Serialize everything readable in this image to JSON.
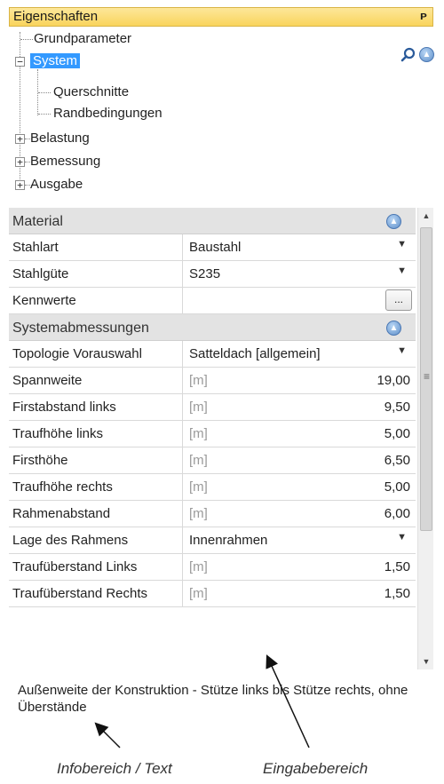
{
  "panel": {
    "title": "Eigenschaften",
    "pin_glyph": "ᴩ"
  },
  "tree": {
    "items": [
      {
        "label": "Grundparameter"
      },
      {
        "label": "System"
      },
      {
        "label": "Querschnitte"
      },
      {
        "label": "Randbedingungen"
      },
      {
        "label": "Belastung"
      },
      {
        "label": "Bemessung"
      },
      {
        "label": "Ausgabe"
      }
    ],
    "expand_symbol": "+",
    "collapse_symbol": "−"
  },
  "categories": {
    "material": "Material",
    "system": "Systemabmessungen"
  },
  "rows": [
    {
      "name": "Stahlart",
      "value": "Baustahl"
    },
    {
      "name": "Stahlgüte",
      "value": "S235"
    },
    {
      "name": "Kennwerte",
      "value": "",
      "button": "..."
    },
    {
      "name": "Topologie Vorauswahl",
      "value": "Satteldach [allgemein]"
    },
    {
      "name": "Spannweite",
      "unit": "[m]",
      "num": "19,00"
    },
    {
      "name": "Firstabstand links",
      "unit": "[m]",
      "num": "9,50"
    },
    {
      "name": "Traufhöhe links",
      "unit": "[m]",
      "num": "5,00"
    },
    {
      "name": "Firsthöhe",
      "unit": "[m]",
      "num": "6,50"
    },
    {
      "name": "Traufhöhe rechts",
      "unit": "[m]",
      "num": "5,00"
    },
    {
      "name": "Rahmenabstand",
      "unit": "[m]",
      "num": "6,00"
    },
    {
      "name": "Lage des Rahmens",
      "value": "Innenrahmen"
    },
    {
      "name": "Traufüberstand Links",
      "unit": "[m]",
      "num": "1,50"
    },
    {
      "name": "Traufüberstand Rechts",
      "unit": "[m]",
      "num": "1,50"
    }
  ],
  "info_text": "Außenweite der Konstruktion - Stütze links bis Stütze rechts, ohne Überstände",
  "captions": {
    "left": "Infobereich / Text",
    "right": "Eingabebereich"
  },
  "icons": {
    "search": "search-icon",
    "collapse": "collapse-up-icon",
    "dropdown": "chevron-down-icon"
  },
  "colors": {
    "title_bar": "#f9d45c",
    "selection": "#3399ff",
    "category_bg": "#e3e3e3"
  }
}
